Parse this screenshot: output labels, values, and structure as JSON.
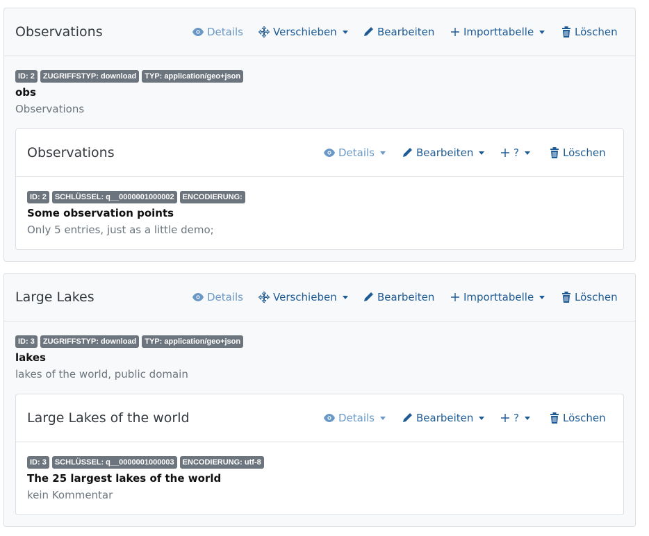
{
  "colors": {
    "link": "#1e5b94",
    "link_muted": "#6a98c6",
    "badge": "#6c757d"
  },
  "cards": [
    {
      "title": "Observations",
      "actions": {
        "details": "Details",
        "move": "Verschieben",
        "edit": "Bearbeiten",
        "import": "Importtabelle",
        "delete": "Löschen"
      },
      "badges": [
        "ID: 2",
        "ZUGRIFFSTYP: download",
        "TYP: application/geo+json"
      ],
      "name": "obs",
      "comment": "Observations",
      "inner": {
        "title": "Observations",
        "actions": {
          "details": "Details",
          "edit": "Bearbeiten",
          "add": "?",
          "delete": "Löschen"
        },
        "badges": [
          "ID: 2",
          "SCHLÜSSEL: q__0000001000002",
          "ENCODIERUNG:"
        ],
        "name": "Some observation points",
        "comment": "Only 5 entries, just as a little demo;"
      }
    },
    {
      "title": "Large Lakes",
      "actions": {
        "details": "Details",
        "move": "Verschieben",
        "edit": "Bearbeiten",
        "import": "Importtabelle",
        "delete": "Löschen"
      },
      "badges": [
        "ID: 3",
        "ZUGRIFFSTYP: download",
        "TYP: application/geo+json"
      ],
      "name": "lakes",
      "comment": "lakes of the world, public domain",
      "inner": {
        "title": "Large Lakes of the world",
        "actions": {
          "details": "Details",
          "edit": "Bearbeiten",
          "add": "?",
          "delete": "Löschen"
        },
        "badges": [
          "ID: 3",
          "SCHLÜSSEL: q__0000001000003",
          "ENCODIERUNG: utf-8"
        ],
        "name": "The 25 largest lakes of the world",
        "comment": "kein Kommentar"
      }
    }
  ]
}
